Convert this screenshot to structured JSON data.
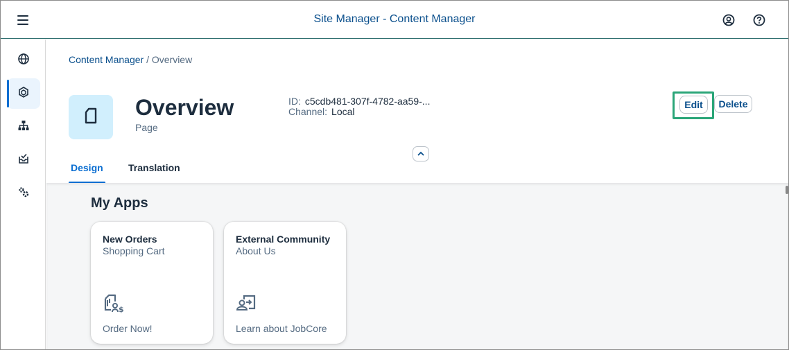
{
  "shell": {
    "title": "Site Manager - Content Manager",
    "icons": [
      "menu-icon",
      "user-icon",
      "help-icon"
    ]
  },
  "sidenav": {
    "items": [
      {
        "name": "globe-icon",
        "selected": false
      },
      {
        "name": "content-icon",
        "selected": true
      },
      {
        "name": "hierarchy-icon",
        "selected": false
      },
      {
        "name": "inbox-icon",
        "selected": false
      },
      {
        "name": "settings-icon",
        "selected": false
      }
    ]
  },
  "header": {
    "breadcrumb": {
      "link": "Content Manager",
      "separator": "/",
      "current": "Overview"
    },
    "title": "Overview",
    "subtitle": "Page",
    "id_label": "ID:",
    "id_value": "c5cdb481-307f-4782-aa59-...",
    "channel_label": "Channel:",
    "channel_value": "Local",
    "edit_label": "Edit",
    "delete_label": "Delete"
  },
  "tabs": [
    {
      "label": "Design",
      "active": true
    },
    {
      "label": "Translation",
      "active": false
    }
  ],
  "section": {
    "title": "My Apps",
    "tiles": [
      {
        "title": "New Orders",
        "subtitle": "Shopping Cart",
        "icon": "shopping-cart-icon",
        "footer": "Order Now!"
      },
      {
        "title": "External Community",
        "subtitle": "About Us",
        "icon": "community-icon",
        "footer": "Learn about JobCore"
      }
    ]
  },
  "colors": {
    "accent": "#0a6ed1",
    "link": "#0a4f8c",
    "highlight_border": "#2aa578",
    "avatar_bg": "#d1effd"
  }
}
